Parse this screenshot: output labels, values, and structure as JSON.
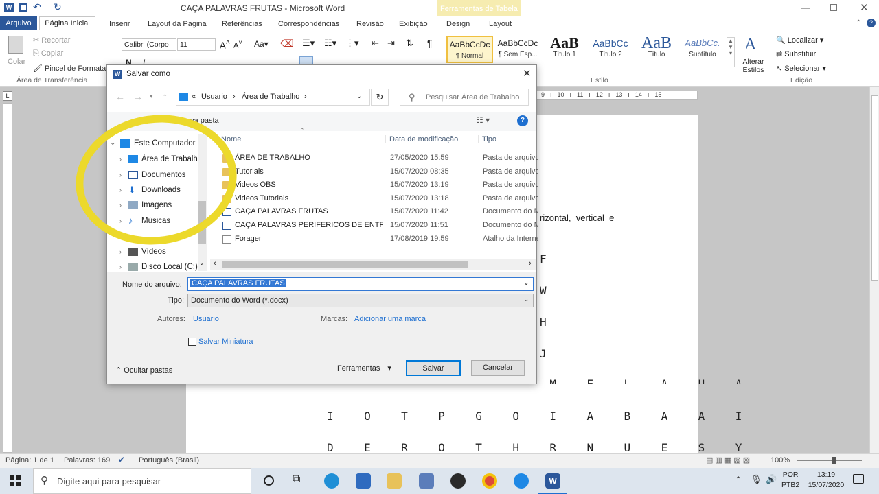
{
  "window": {
    "title": "CAÇA PALAVRAS FRUTAS",
    "app": "Microsoft Word",
    "ctx_tab": "Ferramentas de Tabela"
  },
  "ribbon_tabs": {
    "arquivo": "Arquivo",
    "inicial": "Página Inicial",
    "inserir": "Inserir",
    "layout_pagina": "Layout da Página",
    "referencias": "Referências",
    "correspondencias": "Correspondências",
    "revisao": "Revisão",
    "exibicao": "Exibição",
    "design": "Design",
    "layout": "Layout"
  },
  "clipboard": {
    "colar": "Colar",
    "recortar": "Recortar",
    "copiar": "Copiar",
    "pincel": "Pincel de Formatação",
    "group": "Área de Transferência"
  },
  "font": {
    "name": "Calibri (Corpo",
    "size": "11"
  },
  "styles": {
    "items": [
      {
        "sample": "AaBbCcDc",
        "name": "¶ Normal"
      },
      {
        "sample": "AaBbCcDc",
        "name": "¶ Sem Esp..."
      },
      {
        "sample": "AaB",
        "name": "Título 1"
      },
      {
        "sample": "AaBbCc",
        "name": "Título 2"
      },
      {
        "sample": "AaB",
        "name": "Título"
      },
      {
        "sample": "AaBbCc.",
        "name": "Subtítulo"
      }
    ],
    "alterar": "Alterar Estilos",
    "group": "Estilo"
  },
  "editing": {
    "localizar": "Localizar",
    "substituir": "Substituir",
    "selecionar": "Selecionar",
    "group": "Edição"
  },
  "ruler": "9 · ı · 10 · ı · 11 · ı · 12 · ı · 13 · ı · 14 · ı · 15",
  "document": {
    "text_fragment": "rizontal,  vertical  e",
    "rows": [
      "F",
      "W",
      "H",
      "J",
      "M O R M U N M E L A U A",
      "I O T P G O I A B A A I",
      "D E R O T H R N U E S Y"
    ]
  },
  "dialog": {
    "title": "Salvar como",
    "breadcrumb": {
      "prefix": "«",
      "usuario": "Usuario",
      "area": "Área de Trabalho"
    },
    "search_placeholder": "Pesquisar Área de Trabalho",
    "nova_pasta": "Nova pasta",
    "tree": [
      "Este Computador",
      "Área de Trabalho",
      "Documentos",
      "Downloads",
      "Imagens",
      "Músicas",
      "Vídeos",
      "Disco Local (C:)"
    ],
    "columns": {
      "name": "Nome",
      "date": "Data de modificação",
      "type": "Tipo"
    },
    "files": [
      {
        "name": "ÁREA DE TRABALHO",
        "date": "27/05/2020 15:59",
        "type": "Pasta de arquivos",
        "kind": "folder"
      },
      {
        "name": "Tutoriais",
        "date": "15/07/2020 08:35",
        "type": "Pasta de arquivos",
        "kind": "folder"
      },
      {
        "name": "Videos OBS",
        "date": "15/07/2020 13:19",
        "type": "Pasta de arquivos",
        "kind": "folder"
      },
      {
        "name": "Videos Tutoriais",
        "date": "15/07/2020 13:18",
        "type": "Pasta de arquivos",
        "kind": "folder"
      },
      {
        "name": "CAÇA PALAVRAS FRUTAS",
        "date": "15/07/2020 11:42",
        "type": "Documento do Microsoft Word",
        "kind": "doc"
      },
      {
        "name": "CAÇA PALAVRAS PERIFERICOS DE ENTRA...",
        "date": "15/07/2020 11:51",
        "type": "Documento do Microsoft Word",
        "kind": "doc"
      },
      {
        "name": "Forager",
        "date": "17/08/2019 19:59",
        "type": "Atalho da Internet",
        "kind": "link"
      }
    ],
    "filename_label": "Nome do arquivo:",
    "filename_value": "CAÇA PALAVRAS FRUTAS",
    "type_label": "Tipo:",
    "type_value": "Documento do Word (*.docx)",
    "autores_label": "Autores:",
    "autores_value": "Usuario",
    "marcas_label": "Marcas:",
    "marcas_value": "Adicionar uma marca",
    "miniatura": "Salvar Miniatura",
    "ocultar": "Ocultar pastas",
    "ferramentas": "Ferramentas",
    "salvar": "Salvar",
    "cancelar": "Cancelar"
  },
  "status": {
    "pagina": "Página: 1 de 1",
    "palavras": "Palavras: 169",
    "idioma": "Português (Brasil)",
    "zoom": "100%"
  },
  "taskbar": {
    "search": "Digite aqui para pesquisar",
    "lang1": "POR",
    "lang2": "PTB2",
    "time": "13:19",
    "date": "15/07/2020"
  },
  "colors": {
    "accent": "#2b579a",
    "highlight_circle": "#ecd92b",
    "selection": "#3378d4"
  }
}
